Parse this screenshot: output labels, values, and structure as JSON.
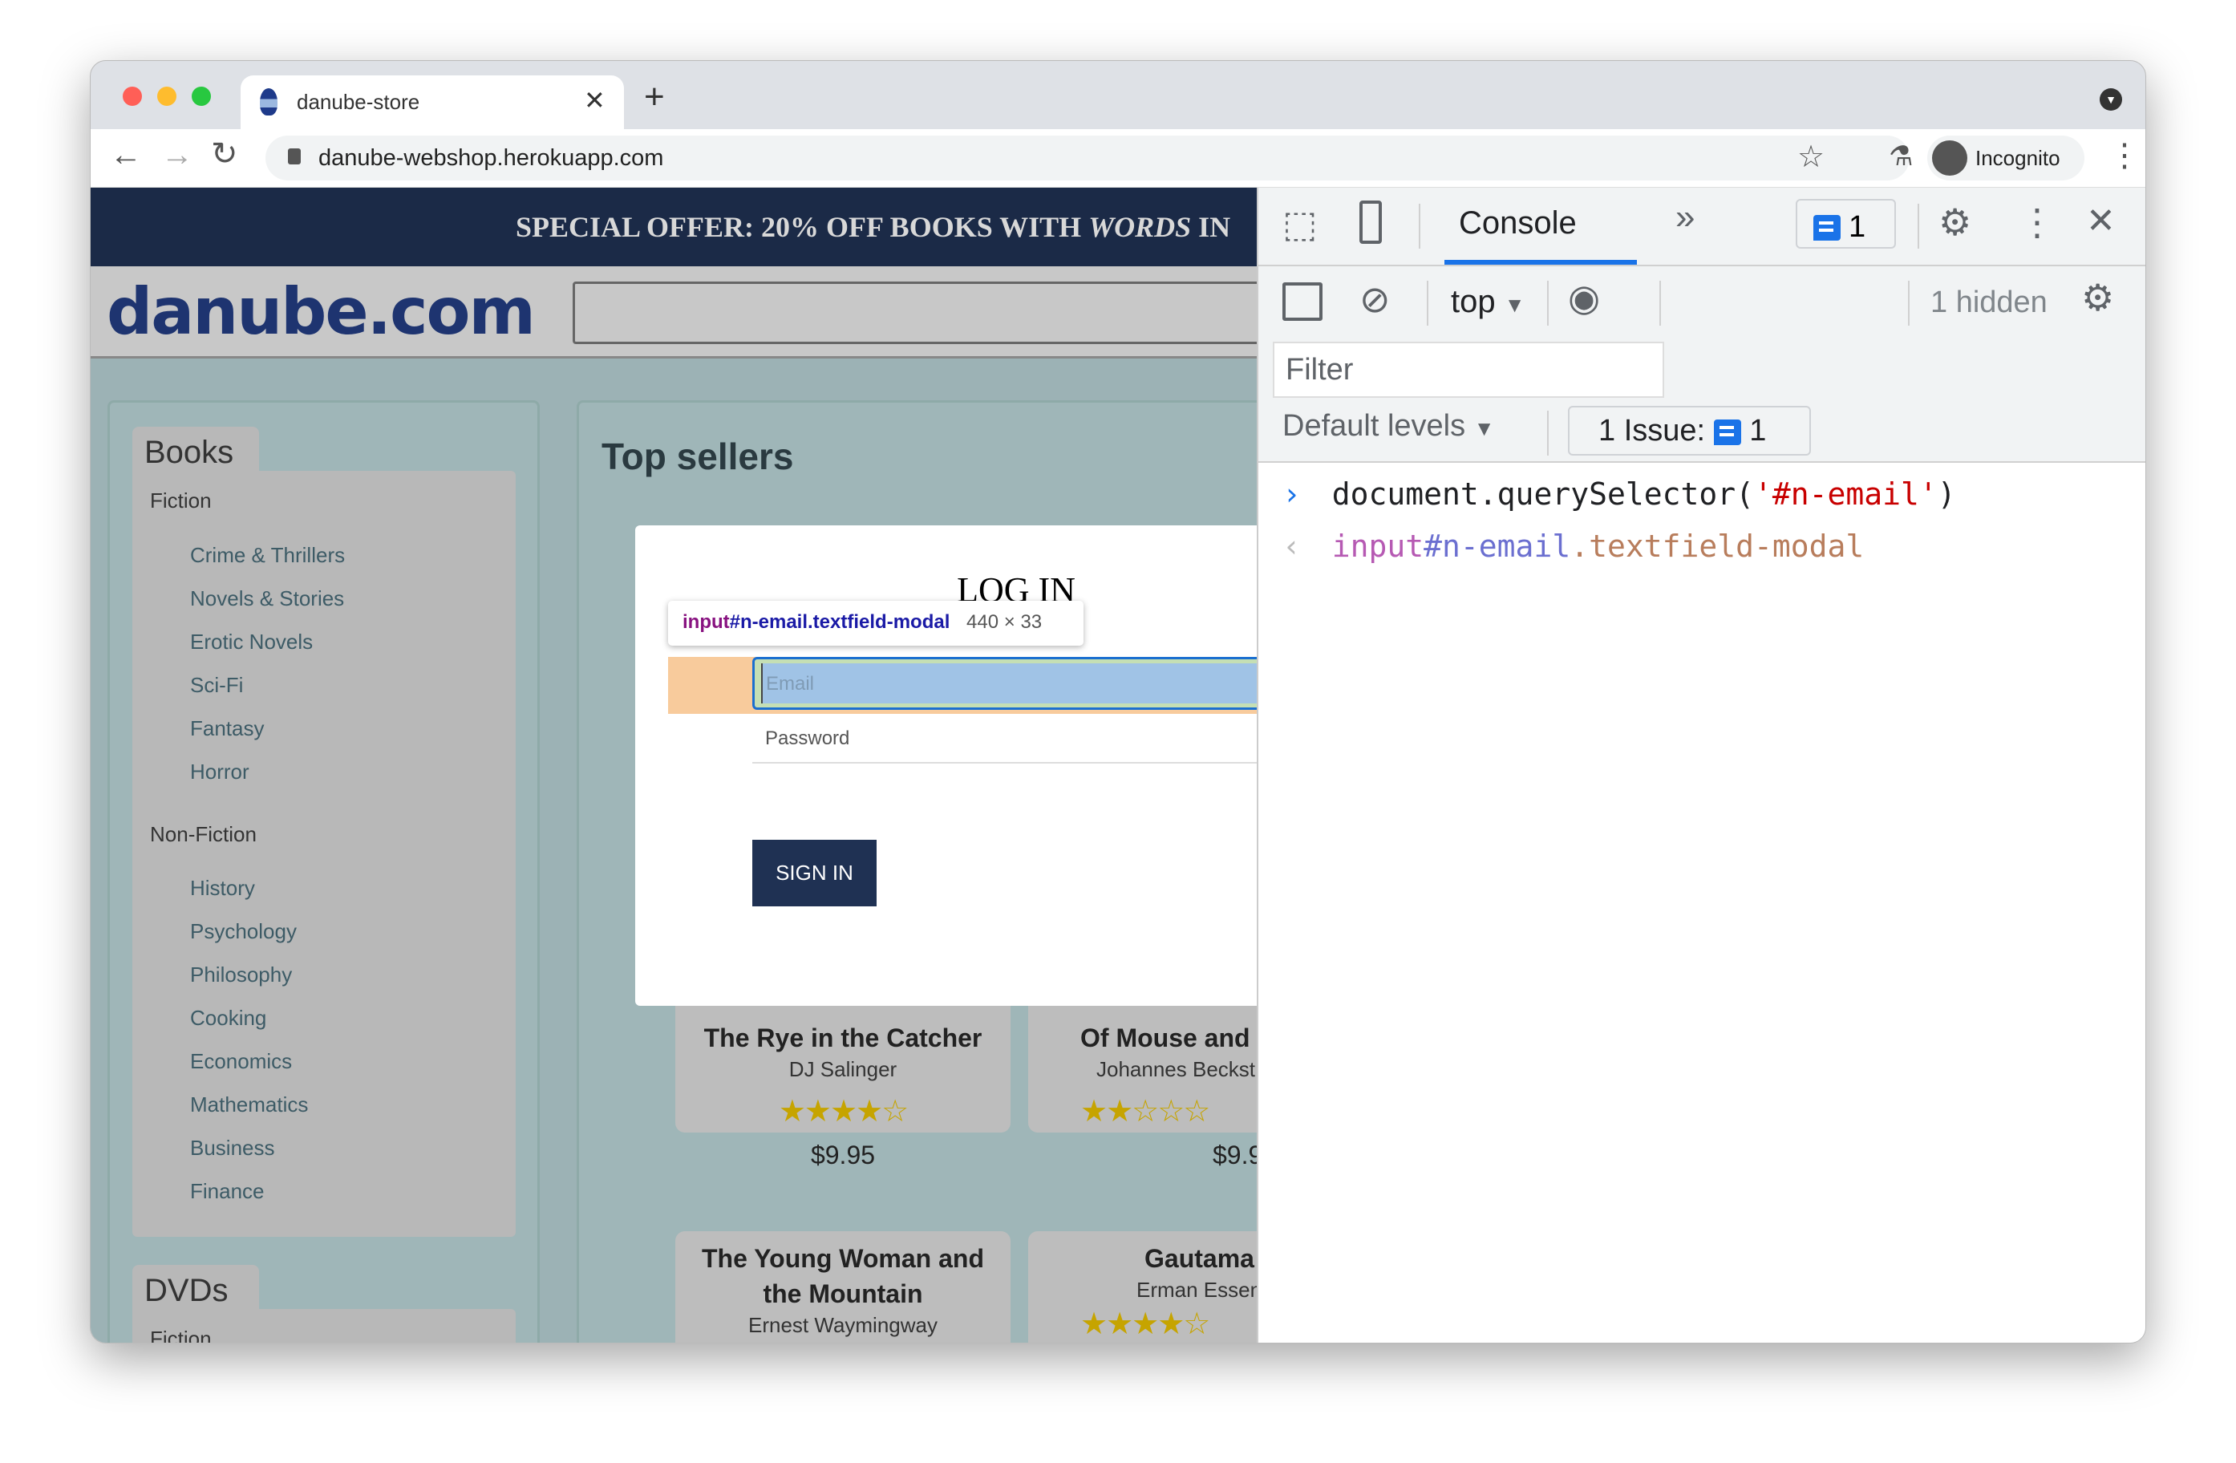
{
  "browser": {
    "tab_title": "danube-store",
    "url": "danube-webshop.herokuapp.com",
    "profile": "Incognito"
  },
  "page": {
    "banner": "SPECIAL OFFER: 20% OFF BOOKS WITH",
    "banner_italic": "WORDS",
    "banner_tail": "IN",
    "logo": "danube.com",
    "sidebar": {
      "books_tab": "Books",
      "fiction": "Fiction",
      "fiction_items": [
        "Crime & Thrillers",
        "Novels & Stories",
        "Erotic Novels",
        "Sci-Fi",
        "Fantasy",
        "Horror"
      ],
      "nonfiction": "Non-Fiction",
      "nonfiction_items": [
        "History",
        "Psychology",
        "Philosophy",
        "Cooking",
        "Economics",
        "Mathematics",
        "Business",
        "Finance"
      ],
      "dvds_tab": "DVDs",
      "dvds_fiction": "Fiction"
    },
    "top_sellers": "Top sellers",
    "books": [
      {
        "title": "The Rye in the Catcher",
        "author": "DJ Salinger",
        "rating": 4,
        "price": "$9.95"
      },
      {
        "title": "Of Mouse and",
        "author": "Johannes Beckst",
        "rating": 2,
        "price": "$9.95"
      },
      {
        "title": "The Young Woman and the Mountain",
        "author": "Ernest Waymingway",
        "rating": null,
        "price": null
      },
      {
        "title": "Gautama",
        "author": "Erman Essen",
        "rating": 4,
        "price": null
      }
    ],
    "modal": {
      "title": "LOG IN",
      "email_placeholder": "Email",
      "password_placeholder": "Password",
      "sign_in": "SIGN IN"
    },
    "inspect_tooltip": {
      "tag": "input",
      "id": "#n-email",
      "cls": ".textfield-modal",
      "size": "440 × 33"
    }
  },
  "devtools": {
    "tab": "Console",
    "issues_badge": "1",
    "context": "top",
    "hidden": "1 hidden",
    "filter_placeholder": "Filter",
    "levels": "Default levels",
    "issue_label": "1 Issue:",
    "issue_count": "1",
    "input": {
      "fn": "document.querySelector(",
      "arg": "'#n-email'",
      "close": ")"
    },
    "output": {
      "tag": "input",
      "id": "#n-email",
      "cls": ".textfield-modal"
    },
    "accent": "#1a73e8"
  }
}
